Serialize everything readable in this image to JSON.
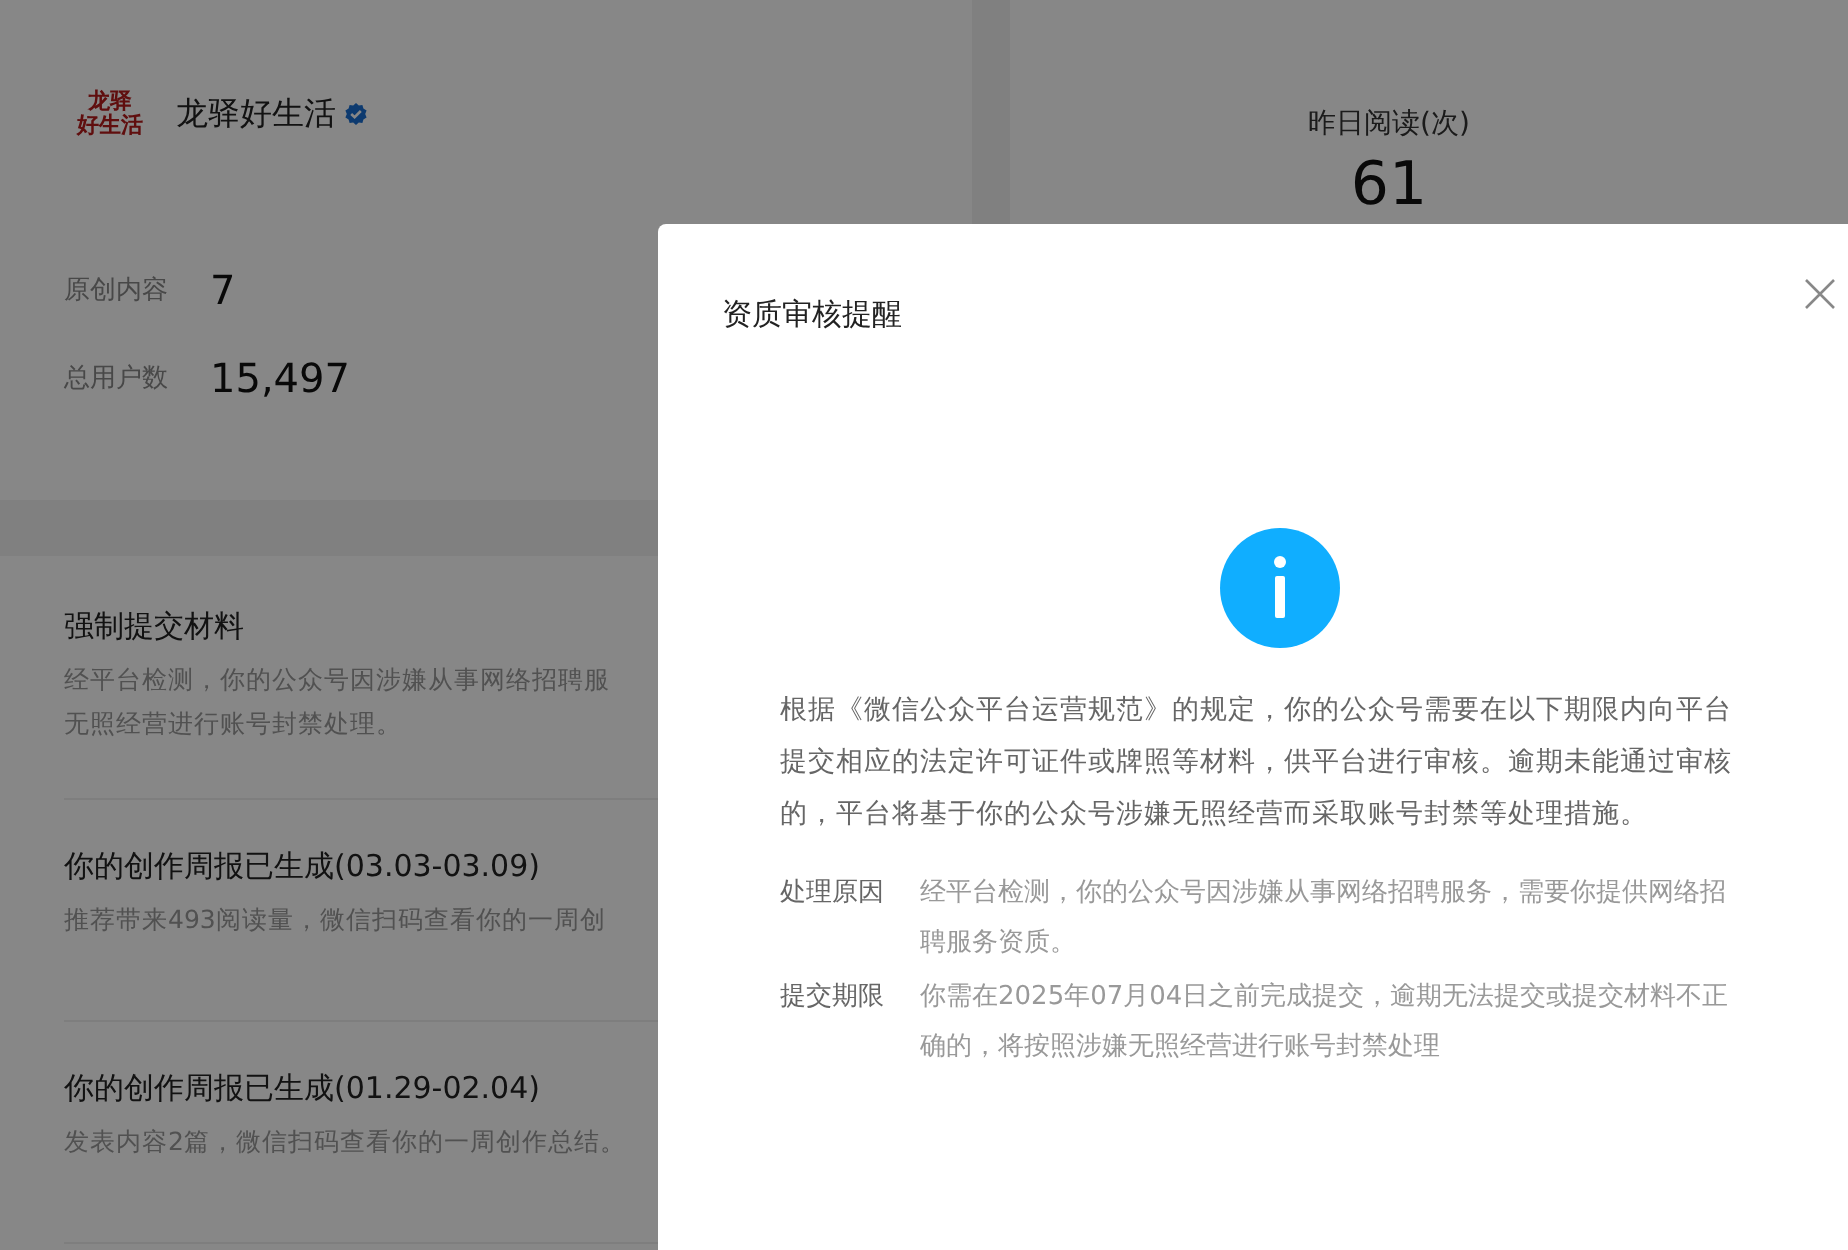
{
  "account": {
    "logo_lines": [
      "龙驿",
      "好生活"
    ],
    "name": "龙驿好生活",
    "verified": true,
    "stats": [
      {
        "label": "原创内容",
        "value": "7"
      },
      {
        "label": "总用户数",
        "value": "15,497"
      }
    ]
  },
  "reads": {
    "label": "昨日阅读(次)",
    "value": "61"
  },
  "notices": [
    {
      "title": "强制提交材料",
      "lines": [
        "经平台检测，你的公众号因涉嫌从事网络招聘服",
        "无照经营进行账号封禁处理。"
      ]
    },
    {
      "title": "你的创作周报已生成(03.03-03.09)",
      "lines": [
        "推荐带来493阅读量，微信扫码查看你的一周创"
      ]
    },
    {
      "title": "你的创作周报已生成(01.29-02.04)",
      "lines": [
        "发表内容2篇，微信扫码查看你的一周创作总结。"
      ]
    }
  ],
  "dialog": {
    "title": "资质审核提醒",
    "message": "根据《微信公众平台运营规范》的规定，你的公众号需要在以下期限内向平台提交相应的法定许可证件或牌照等材料，供平台进行审核。逾期未能通过审核的，平台将基于你的公众号涉嫌无照经营而采取账号封禁等处理措施。",
    "details": [
      {
        "label": "处理原因",
        "text": "经平台检测，你的公众号因涉嫌从事网络招聘服务，需要你提供网络招聘服务资质。"
      },
      {
        "label": "提交期限",
        "text": "你需在2025年07月04日之前完成提交，逾期无法提交或提交材料不正确的，将按照涉嫌无照经营进行账号封禁处理"
      }
    ]
  }
}
